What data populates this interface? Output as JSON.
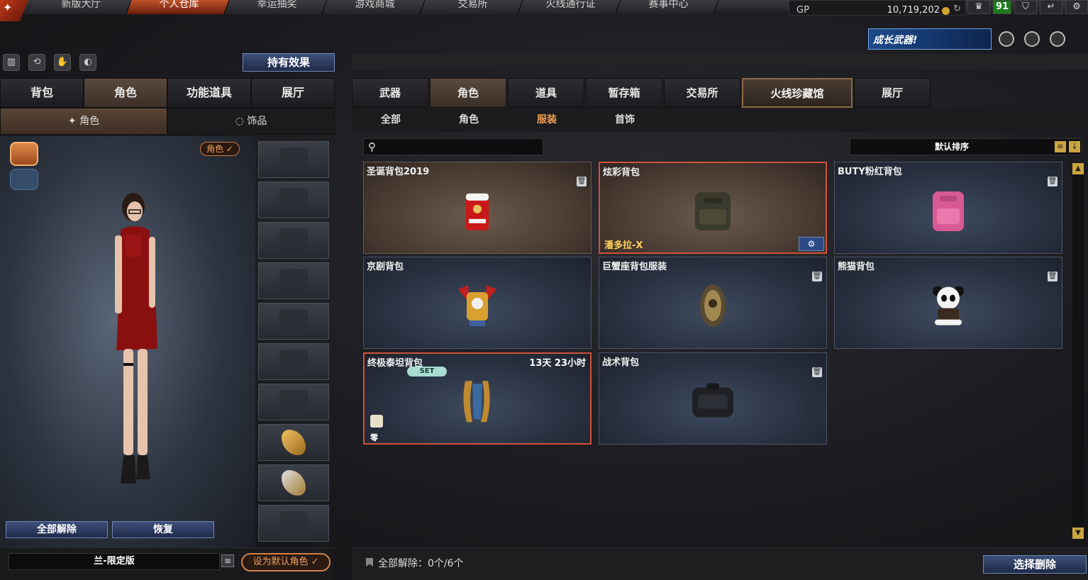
{
  "nav": {
    "tabs": [
      "新版大厅",
      "个人仓库",
      "幸运抽奖",
      "游戏商城",
      "交易所",
      "火线通行证",
      "赛事中心"
    ],
    "active": 1
  },
  "currency": {
    "label": "GP",
    "value": "10,719,202"
  },
  "level": "91",
  "banner": {
    "text": "成长武器!"
  },
  "left": {
    "effect_button": "持有效果",
    "tabs": [
      "背包",
      "角色",
      "功能道具",
      "展厅"
    ],
    "active_tab": 1,
    "subtabs": [
      "角色",
      "饰品"
    ],
    "active_subtab": 0,
    "role_badge": "角色 ✓",
    "release_all": "全部解除",
    "restore": "恢复",
    "character_name": "兰-限定版",
    "set_default": "设为默认角色 ✓"
  },
  "right": {
    "tabs": [
      "武器",
      "角色",
      "道具",
      "暂存箱",
      "交易所",
      "火线珍藏馆",
      "展厅"
    ],
    "active_tab": 1,
    "highlight_tab": 5,
    "subtabs": [
      "全部",
      "角色",
      "服装",
      "首饰"
    ],
    "active_subtab": 2,
    "search_placeholder": "",
    "sort_label": "默认排序",
    "items": [
      {
        "title": "圣诞背包2019",
        "style": "brown"
      },
      {
        "title": "炫彩背包",
        "style": "brown",
        "owner": "潘多拉-X",
        "selected": true
      },
      {
        "title": "BUTY粉红背包",
        "style": "blue"
      },
      {
        "title": "京剧背包",
        "style": "blue"
      },
      {
        "title": "巨蟹座背包服装",
        "style": "blue"
      },
      {
        "title": "熊猫背包",
        "style": "blue"
      },
      {
        "title": "终极泰坦背包",
        "style": "blue",
        "timer": "13天 23小时",
        "set": "SET",
        "zero": "零",
        "selected": true
      },
      {
        "title": "战术背包",
        "style": "blue"
      }
    ],
    "remove_count": "全部解除：0个/6个",
    "select_delete": "选择删除"
  },
  "colors": {
    "accent": "#d0523a",
    "gold": "#caa640",
    "button_blue": "#3d4f7a"
  }
}
